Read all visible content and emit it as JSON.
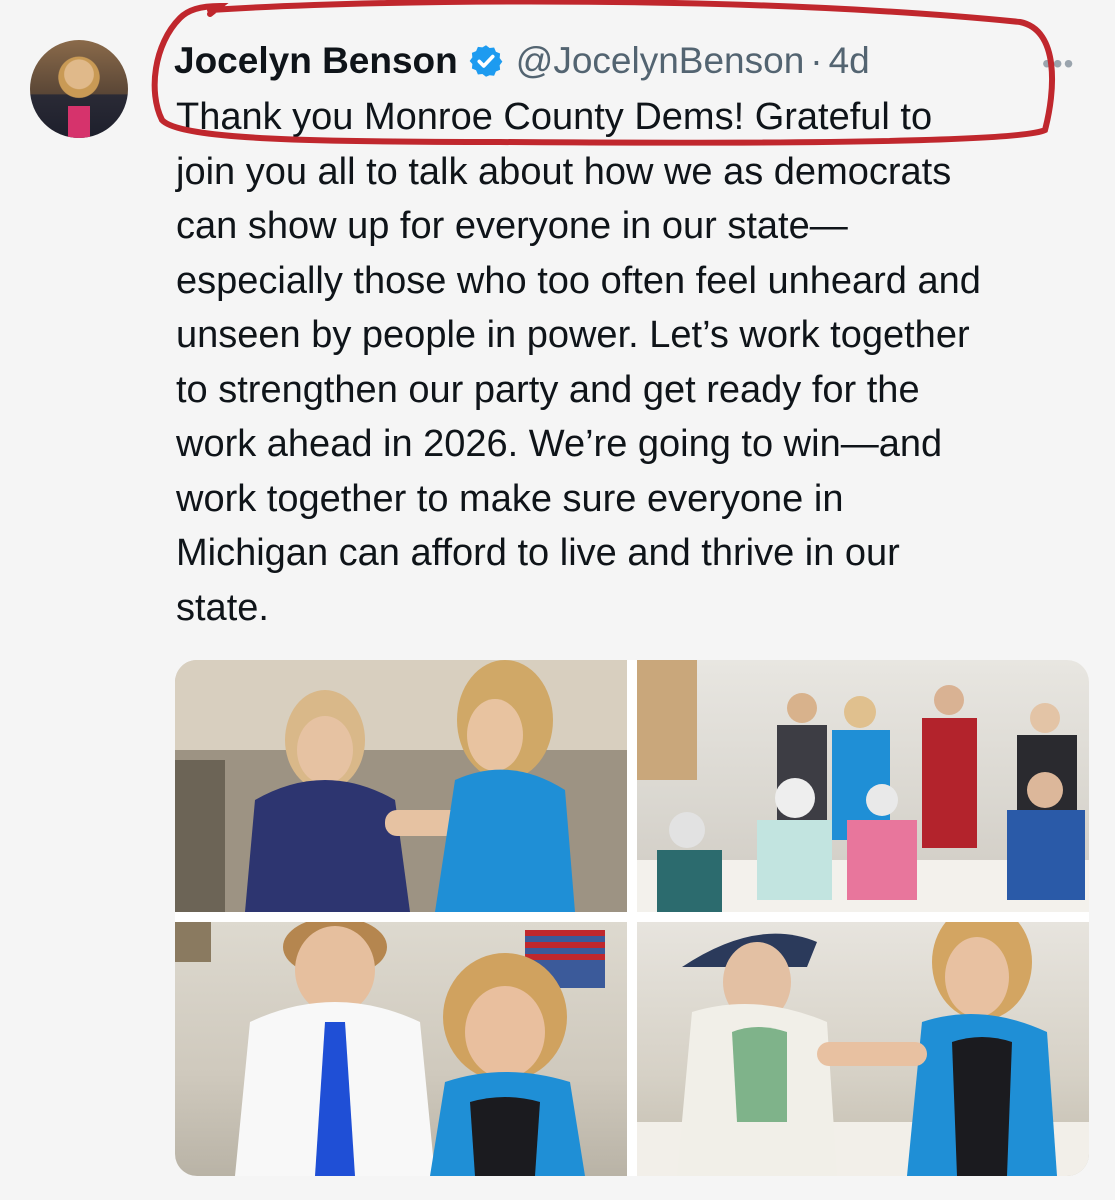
{
  "tweet": {
    "author_name": "Jocelyn Benson",
    "handle": "@JocelynBenson",
    "separator": "·",
    "time": "4d",
    "more": "•••",
    "text": "Thank you Monroe County Dems! Grateful to\njoin you all to talk about how we as democrats\ncan show up for everyone in our state—\nespecially those who too often feel unheard and\nunseen by people in power. Let’s work together\nto strengthen our party and get ready for the\nwork ahead in 2026. We’re going to win—and\nwork together to make sure everyone in\nMichigan can afford to live and thrive in our\nstate."
  },
  "colors": {
    "background": "#f5f5f5",
    "handle": "#536471",
    "verified": "#1d9bf0",
    "annotation": "#c0272d",
    "blazer": "#1f8fd6"
  },
  "icons": {
    "verified": "verified-badge-icon",
    "more": "more-options-icon"
  }
}
